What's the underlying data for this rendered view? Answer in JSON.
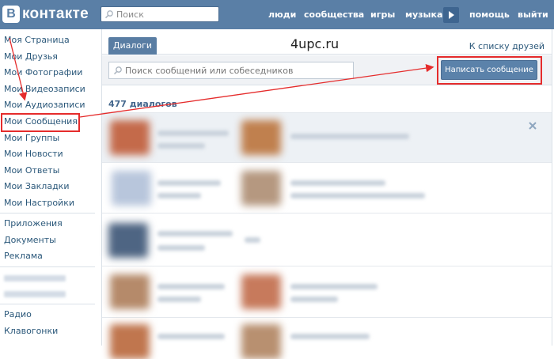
{
  "header": {
    "logo_letter": "B",
    "logo_text": "контакте",
    "search_placeholder": "Поиск",
    "nav": [
      {
        "label": "люди"
      },
      {
        "label": "сообщества"
      },
      {
        "label": "игры"
      },
      {
        "label": "музыка"
      },
      {
        "label": "помощь"
      },
      {
        "label": "выйти"
      }
    ]
  },
  "sidebar": {
    "items": [
      {
        "label": "Моя Страница"
      },
      {
        "label": "Мои Друзья"
      },
      {
        "label": "Мои Фотографии"
      },
      {
        "label": "Мои Видеозаписи"
      },
      {
        "label": "Мои Аудиозаписи"
      },
      {
        "label": "Мои Сообщения"
      },
      {
        "label": "Мои Группы"
      },
      {
        "label": "Мои Новости"
      },
      {
        "label": "Мои Ответы"
      },
      {
        "label": "Мои Закладки"
      },
      {
        "label": "Мои Настройки"
      }
    ],
    "extra": [
      {
        "label": "Приложения"
      },
      {
        "label": "Документы"
      },
      {
        "label": "Реклама"
      }
    ],
    "bottom": [
      {
        "label": "Радио"
      },
      {
        "label": "Клавогонки"
      }
    ]
  },
  "main": {
    "tab_label": "Диалоги",
    "site_name": "4upc.ru",
    "friends_link": "К списку друзей",
    "search_placeholder": "Поиск сообщений или собеседников",
    "write_button": "Написать сообщение",
    "dialog_count": "477 диалогов"
  },
  "colors": {
    "header_bg": "#5a7fa6",
    "link": "#2b587a",
    "highlight": "#e52c2c",
    "button": "#5b82aa"
  }
}
